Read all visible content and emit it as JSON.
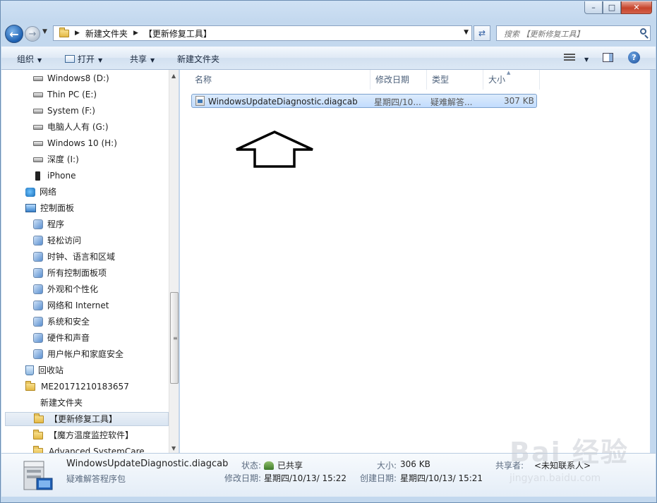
{
  "window": {
    "caption": {
      "minimize": "–",
      "maximize": "□",
      "close": "✕"
    }
  },
  "address": {
    "crumbs": [
      "新建文件夹",
      "【更新修复工具】"
    ],
    "search_placeholder": "搜索 【更新修复工具】"
  },
  "toolbar": {
    "organize": "组织",
    "open": "打开",
    "share": "共享",
    "new_folder": "新建文件夹"
  },
  "nav": {
    "items": [
      {
        "label": "Windows8 (D:)",
        "icon": "drive-icon"
      },
      {
        "label": "Thin PC (E:)",
        "icon": "drive-icon"
      },
      {
        "label": "System (F:)",
        "icon": "drive-icon"
      },
      {
        "label": "电脑人人有 (G:)",
        "icon": "drive-icon"
      },
      {
        "label": "Windows 10 (H:)",
        "icon": "drive-icon"
      },
      {
        "label": "深度 (I:)",
        "icon": "drive-icon"
      },
      {
        "label": "iPhone",
        "icon": "phone-icon"
      },
      {
        "label": "网络",
        "icon": "network-icon"
      },
      {
        "label": "控制面板",
        "icon": "control-panel-icon"
      },
      {
        "label": "程序",
        "icon": "programs-icon"
      },
      {
        "label": "轻松访问",
        "icon": "ease-of-access-icon"
      },
      {
        "label": "时钟、语言和区域",
        "icon": "clock-language-icon"
      },
      {
        "label": "所有控制面板项",
        "icon": "all-cp-items-icon"
      },
      {
        "label": "外观和个性化",
        "icon": "appearance-icon"
      },
      {
        "label": "网络和 Internet",
        "icon": "network-internet-icon"
      },
      {
        "label": "系统和安全",
        "icon": "system-security-icon"
      },
      {
        "label": "硬件和声音",
        "icon": "hardware-sound-icon"
      },
      {
        "label": "用户帐户和家庭安全",
        "icon": "user-accounts-icon"
      },
      {
        "label": "回收站",
        "icon": "recycle-bin-icon"
      },
      {
        "label": "ME20171210183657",
        "icon": "folder-icon"
      },
      {
        "label": "新建文件夹",
        "icon": "none"
      },
      {
        "label": "【更新修复工具】",
        "icon": "folder-icon"
      },
      {
        "label": "【魔方温度监控软件】",
        "icon": "folder-icon"
      },
      {
        "label": "Advanced SystemCare",
        "icon": "folder-icon"
      }
    ]
  },
  "columns": {
    "name": "名称",
    "modified": "修改日期",
    "type": "类型",
    "size": "大小"
  },
  "file": {
    "name": "WindowsUpdateDiagnostic.diagcab",
    "modified": "星期四/10...",
    "type": "疑难解答...",
    "size": "307 KB"
  },
  "details": {
    "name": "WindowsUpdateDiagnostic.diagcab",
    "type": "疑难解答程序包",
    "state_label": "状态:",
    "state_value": "已共享",
    "modified_label": "修改日期:",
    "modified_value": "星期四/10/13/ 15:22",
    "size_label": "大小:",
    "size_value": "306 KB",
    "created_label": "创建日期:",
    "created_value": "星期四/10/13/ 15:21",
    "shared_label": "共享者:",
    "shared_value": "<未知联系人>"
  },
  "watermark": {
    "text": "Bai 经验",
    "sub": "jingyan.baidu.com"
  }
}
